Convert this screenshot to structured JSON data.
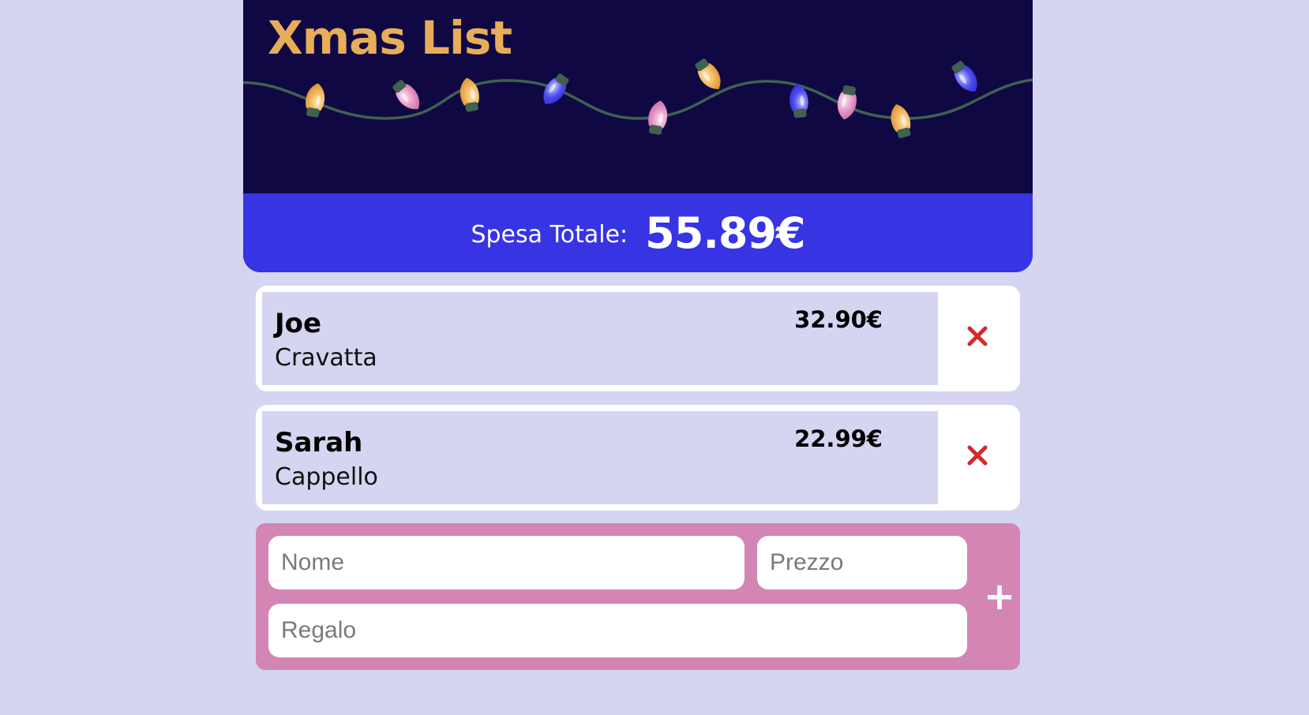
{
  "header": {
    "title": "Xmas List"
  },
  "summary": {
    "total_label": "Spesa Totale:",
    "total_value": "55.89€"
  },
  "gifts": [
    {
      "name": "Joe",
      "gift": "Cravatta",
      "price": "32.90€"
    },
    {
      "name": "Sarah",
      "gift": "Cappello",
      "price": "22.99€"
    }
  ],
  "form": {
    "name_placeholder": "Nome",
    "price_placeholder": "Prezzo",
    "gift_placeholder": "Regalo",
    "add_label": "+"
  },
  "icons": {
    "delete": "close-icon",
    "lights": "christmas-lights-icon"
  },
  "colors": {
    "background": "#d5d5f1",
    "header": "#100843",
    "title": "#e8ad5a",
    "total_bar": "#3634e3",
    "delete": "#d22b2b",
    "form": "#d386b4"
  }
}
